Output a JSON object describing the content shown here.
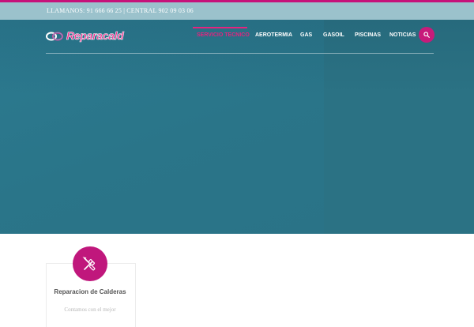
{
  "topbar": {
    "phones": "LLAMANOS: 91 666 66 25 | CENTRAL 902 09 03 06"
  },
  "logo": {
    "text": "Reparacald",
    "icon": "double-loop-logo-icon"
  },
  "nav": {
    "items": [
      {
        "label": "SERVICIO TECNICO",
        "active": true
      },
      {
        "label": "AEROTERMIA",
        "active": false
      },
      {
        "label": "GAS",
        "active": false
      },
      {
        "label": "GASOIL",
        "active": false
      },
      {
        "label": "PISCINAS",
        "active": false
      },
      {
        "label": "NOTICIAS",
        "active": false
      }
    ],
    "search_icon": "search-icon"
  },
  "service_card": {
    "icon": "tools-icon",
    "title": "Reparacion de Calderas",
    "text": "Contamos con el mejor"
  },
  "colors": {
    "accent": "#c6127a",
    "hero": "#2a7488",
    "topbar": "#9bc2cc"
  }
}
